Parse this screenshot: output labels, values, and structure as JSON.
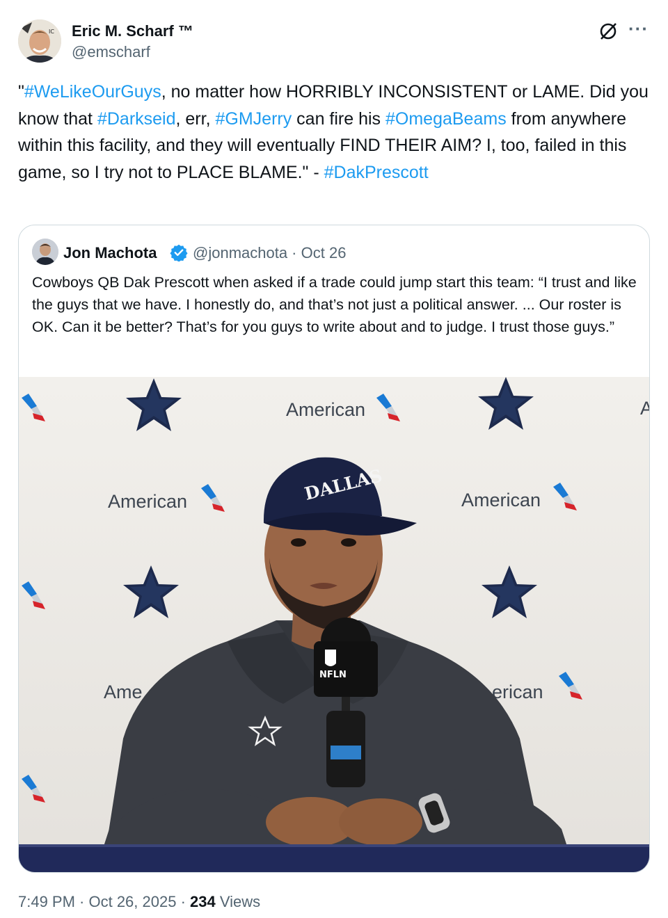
{
  "author": {
    "name": "Eric M. Scharf ™",
    "handle": "@emscharf"
  },
  "tweet": {
    "segments": [
      {
        "text": "\"",
        "tag": false
      },
      {
        "text": "#WeLikeOurGuys",
        "tag": true
      },
      {
        "text": ", no matter how HORRIBLY INCONSISTENT or LAME. Did you know that ",
        "tag": false
      },
      {
        "text": "#Darkseid",
        "tag": true
      },
      {
        "text": ", err, ",
        "tag": false
      },
      {
        "text": "#GMJerry",
        "tag": true
      },
      {
        "text": " can fire his ",
        "tag": false
      },
      {
        "text": "#OmegaBeams",
        "tag": true
      },
      {
        "text": " from anywhere within this facility, and they will eventually FIND THEIR AIM? I, too, failed in this game, so I try not to PLACE BLAME.\" - ",
        "tag": false
      },
      {
        "text": "#DakPrescott",
        "tag": true
      }
    ]
  },
  "quote": {
    "name": "Jon Machota",
    "handle_date": "@jonmachota · Oct 26",
    "text": "Cowboys QB Dak Prescott when asked if a trade could jump start this team: “I trust and like the guys that we have. I honestly do, and that’s not just a political answer. ... Our roster is OK. Can it be better? That’s for you guys to write about and to judge. I trust those guys.”",
    "image": {
      "backdrop_words": [
        "American",
        "American",
        "American",
        "Ame",
        "erican",
        "A"
      ],
      "cap_text": "DALLAS",
      "mic_text": "NFLN"
    }
  },
  "footer": {
    "time": "7:49 PM · Oct 26, 2025 · ",
    "views_count": "234",
    "views_label": " Views"
  },
  "colors": {
    "link": "#1d9bf0",
    "secondary": "#536471",
    "verified": "#1d9bf0"
  }
}
